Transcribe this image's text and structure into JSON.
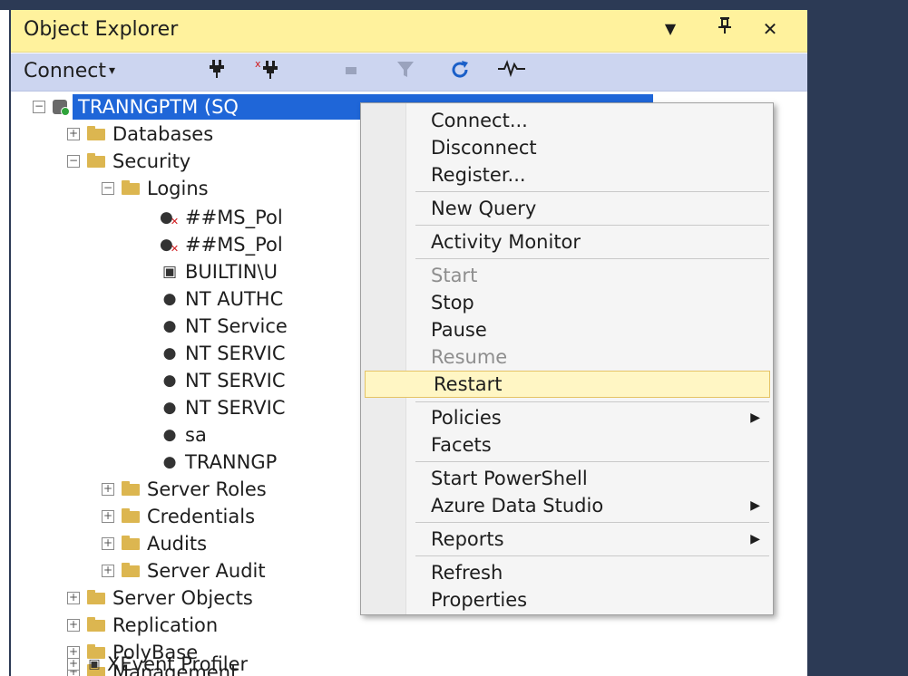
{
  "panel": {
    "title": "Object Explorer",
    "title_buttons": {
      "dropdown": "▼",
      "pin": "ᚙ",
      "close": "✕"
    }
  },
  "toolbar": {
    "connect_label": "Connect",
    "connect_caret": "▾",
    "icons": [
      "connect-icon",
      "disconnect-icon",
      "stop-icon",
      "filter-icon",
      "refresh-icon",
      "activity-monitor-icon"
    ]
  },
  "tree": {
    "server": "TRANNGPTM (SQ",
    "databases": "Databases",
    "security": "Security",
    "logins": "Logins",
    "login_items": [
      "##MS_Pol",
      "##MS_Pol",
      "BUILTIN\\U",
      "NT AUTHC",
      "NT Service",
      "NT SERVIC",
      "NT SERVIC",
      "NT SERVIC",
      "sa",
      "TRANNGP"
    ],
    "server_roles": "Server Roles",
    "credentials": "Credentials",
    "audits": "Audits",
    "server_audit": "Server Audit",
    "server_objects": "Server Objects",
    "replication": "Replication",
    "polybase": "PolyBase",
    "management": "Management",
    "xevent_profiler": "XEvent Profiler"
  },
  "menu": {
    "connect": "Connect...",
    "disconnect": "Disconnect",
    "register": "Register...",
    "new_query": "New Query",
    "activity_monitor": "Activity Monitor",
    "start": "Start",
    "stop": "Stop",
    "pause": "Pause",
    "resume": "Resume",
    "restart": "Restart",
    "policies": "Policies",
    "facets": "Facets",
    "start_powershell": "Start PowerShell",
    "azure_data_studio": "Azure Data Studio",
    "reports": "Reports",
    "refresh": "Refresh",
    "properties": "Properties",
    "submenu_arrow": "▶"
  },
  "colors": {
    "title_bar": "#fff29d",
    "toolbar": "#ccd5f0",
    "selection": "#1f66d8",
    "highlight": "#fff6c4",
    "background_dark": "#2c3a55"
  }
}
